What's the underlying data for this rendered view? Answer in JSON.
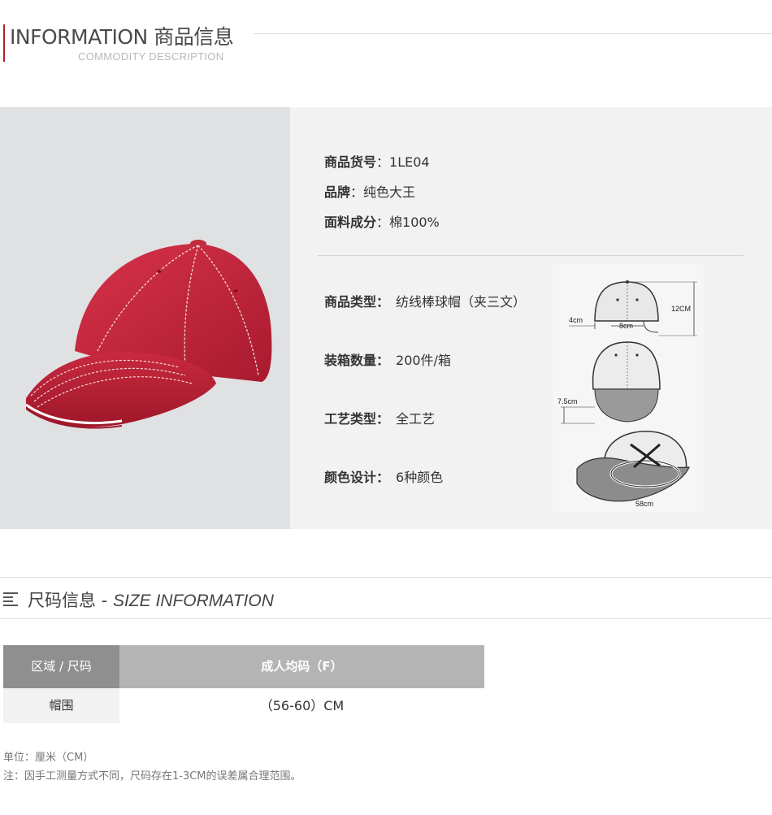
{
  "header": {
    "title": "INFORMATION 商品信息",
    "subtitle": "COMMODITY DESCRIPTION"
  },
  "product": {
    "item_no": {
      "label": "商品货号",
      "value": "：1LE04"
    },
    "brand": {
      "label": "品牌",
      "value": "：纯色大王"
    },
    "material": {
      "label": "面料成分",
      "value": "：棉100%"
    },
    "type": {
      "label": "商品类型：",
      "value": "纺线棒球帽（夹三文）"
    },
    "box_qty": {
      "label": "装箱数量：",
      "value": "200件/箱"
    },
    "craft": {
      "label": "工艺类型：",
      "value": "全工艺"
    },
    "colors": {
      "label": "颜色设计：",
      "value": "6种颜色"
    },
    "cap_color": "#c8263c"
  },
  "diagram": {
    "height_label": "12CM",
    "width_label": "8cm",
    "side_label": "4cm",
    "brim_label": "7.5cm",
    "circ_label": "58cm"
  },
  "size": {
    "title_cn": "尺码信息 -",
    "title_en": "SIZE INFORMATION",
    "table": {
      "header_region": "区域 / 尺码",
      "header_size": "成人均码（F）",
      "row_label": "帽围",
      "row_value": "（56-60）CM"
    },
    "note_unit": "单位：厘米（CM）",
    "note_text": "注：因手工测量方式不同，尺码存在1-3CM的误差属合理范围。"
  }
}
